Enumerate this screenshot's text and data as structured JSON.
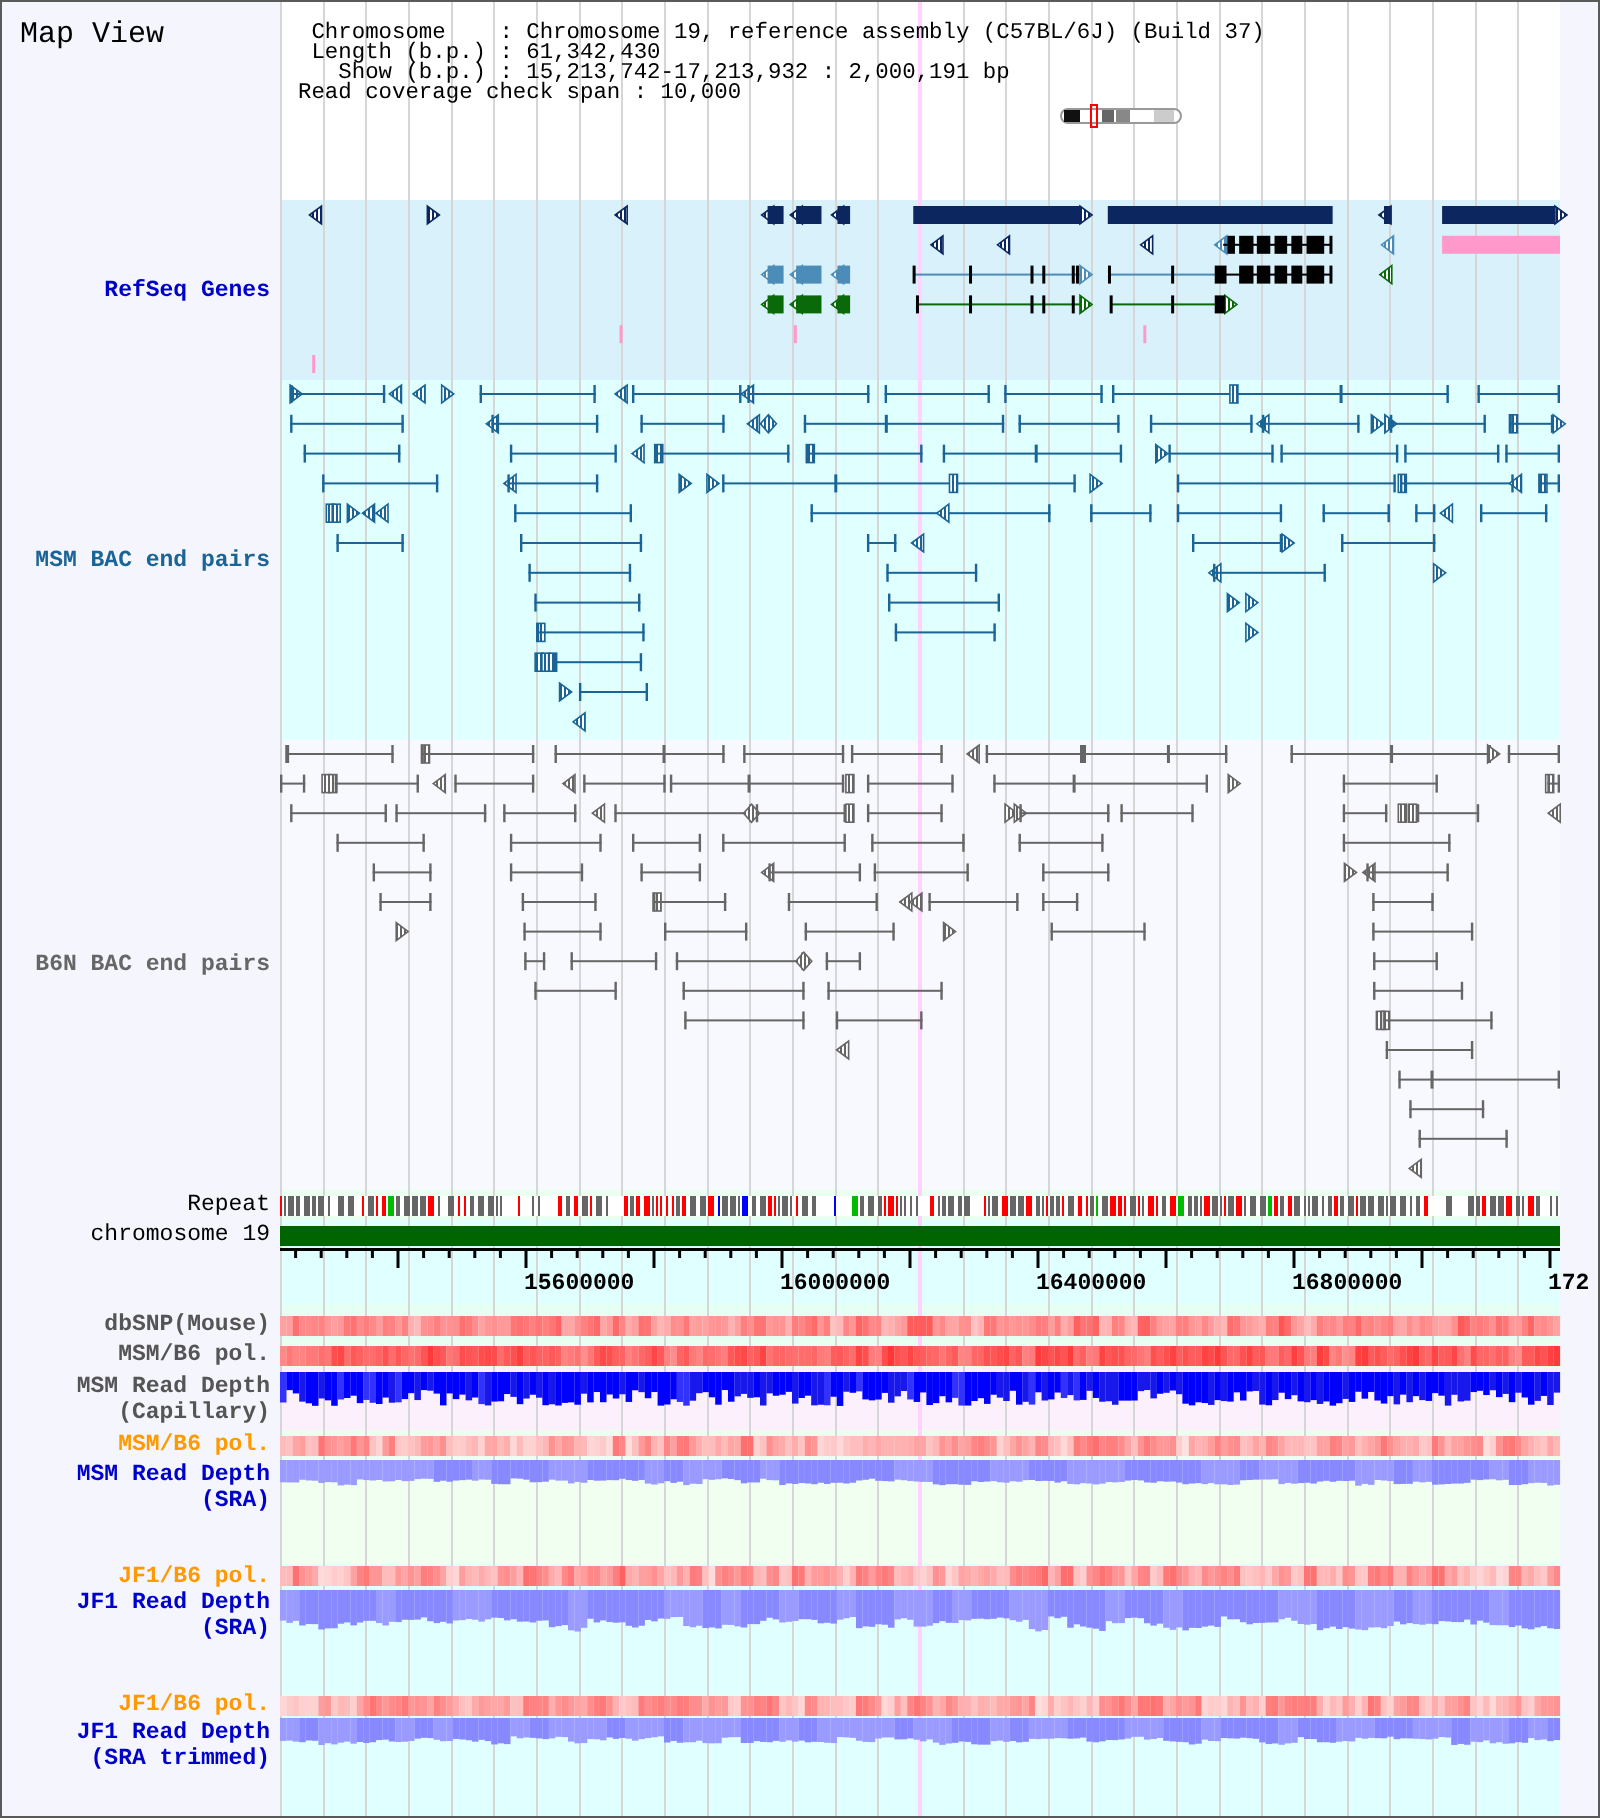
{
  "title": "Map View",
  "header": {
    "lines": [
      " Chromosome    : Chromosome 19, reference assembly (C57BL/6J) (Build 37)",
      " Length (b.p.) : 61,342,430",
      "   Show (b.p.) : 15,213,742-17,213,932 : 2,000,191 bp",
      "Read coverage check span : 10,000"
    ]
  },
  "tracks": [
    {
      "kind": "genes",
      "label": "RefSeq Genes",
      "color": "#0000cc"
    },
    {
      "kind": "bac_pairs",
      "label": "MSM BAC end pairs",
      "color": "#1a6496"
    },
    {
      "kind": "bac_pairs",
      "label": "B6N BAC end pairs",
      "color": "#666666"
    },
    {
      "kind": "repeat",
      "label": "Repeat",
      "color": "#000000"
    },
    {
      "kind": "chromosome",
      "label": "chromosome 19",
      "color": "#000000"
    },
    {
      "kind": "axis",
      "ticks": [
        "15600000",
        "16000000",
        "16400000",
        "16800000",
        "172"
      ]
    },
    {
      "kind": "snp_density",
      "label": "dbSNP(Mouse)",
      "color": "#555555"
    },
    {
      "kind": "snp_density",
      "label": "MSM/B6 pol.",
      "color": "#555555"
    },
    {
      "kind": "capillary_depth",
      "label": "MSM Read Depth (Capillary)",
      "color": "#555555"
    },
    {
      "kind": "snp_density",
      "label": "MSM/B6 pol.",
      "color": "#ff9900"
    },
    {
      "kind": "sra_depth",
      "label": "MSM Read Depth (SRA)",
      "color": "#0000cc"
    },
    {
      "kind": "snp_density",
      "label": "JF1/B6 pol.",
      "color": "#ff9900"
    },
    {
      "kind": "sra_depth",
      "label": "JF1 Read Depth (SRA)",
      "color": "#0000cc"
    },
    {
      "kind": "snp_density",
      "label": "JF1/B6 pol.",
      "color": "#ff9900"
    },
    {
      "kind": "sra_depth",
      "label": "JF1 Read Depth (SRA trimmed)",
      "color": "#0000cc"
    }
  ]
}
